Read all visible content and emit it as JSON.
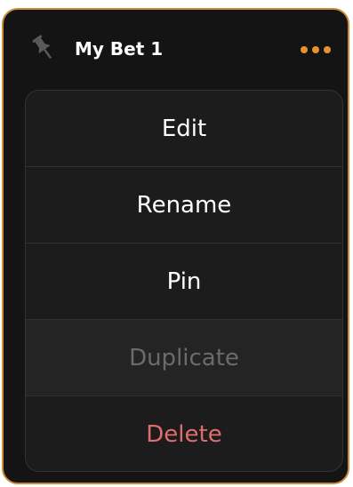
{
  "card": {
    "title": "My Bet 1",
    "pin_icon": "pin-icon",
    "more_icon": "more-horizontal-icon"
  },
  "menu": {
    "items": [
      {
        "label": "Edit",
        "state": "enabled"
      },
      {
        "label": "Rename",
        "state": "enabled"
      },
      {
        "label": "Pin",
        "state": "enabled"
      },
      {
        "label": "Duplicate",
        "state": "disabled"
      },
      {
        "label": "Delete",
        "state": "danger"
      }
    ]
  },
  "colors": {
    "accent": "#e8922e",
    "card_border": "#c98a3a",
    "card_background": "#141414",
    "menu_background": "#1c1c1c",
    "danger": "#e06d6d",
    "disabled_text": "#6b6b6b"
  }
}
